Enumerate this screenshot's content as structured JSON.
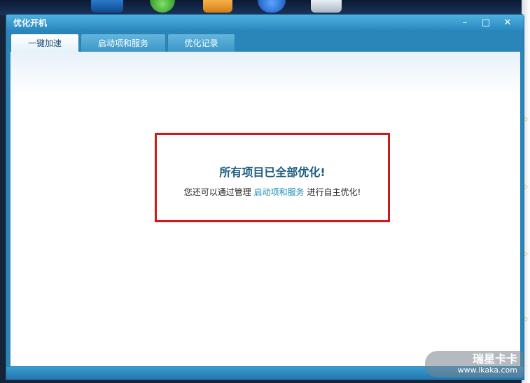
{
  "window": {
    "title": "优化开机",
    "controls": {
      "minimize": "–",
      "maximize": "□",
      "close": "✕"
    }
  },
  "tabs": [
    {
      "label": "一键加速",
      "active": true
    },
    {
      "label": "启动项和服务",
      "active": false
    },
    {
      "label": "优化记录",
      "active": false
    }
  ],
  "message": {
    "headline": "所有项目已全部优化!",
    "sub_prefix": "您还可以通过管理",
    "sub_link": "启动项和服务",
    "sub_suffix": "进行自主优化!"
  },
  "watermark": {
    "brand": "瑞星卡卡",
    "url": "www.ikaka.com"
  },
  "colors": {
    "title_bar": "#2b8ac2",
    "highlight_border": "#cc1b1b",
    "headline": "#1d5e80",
    "link": "#1a8fb7"
  }
}
